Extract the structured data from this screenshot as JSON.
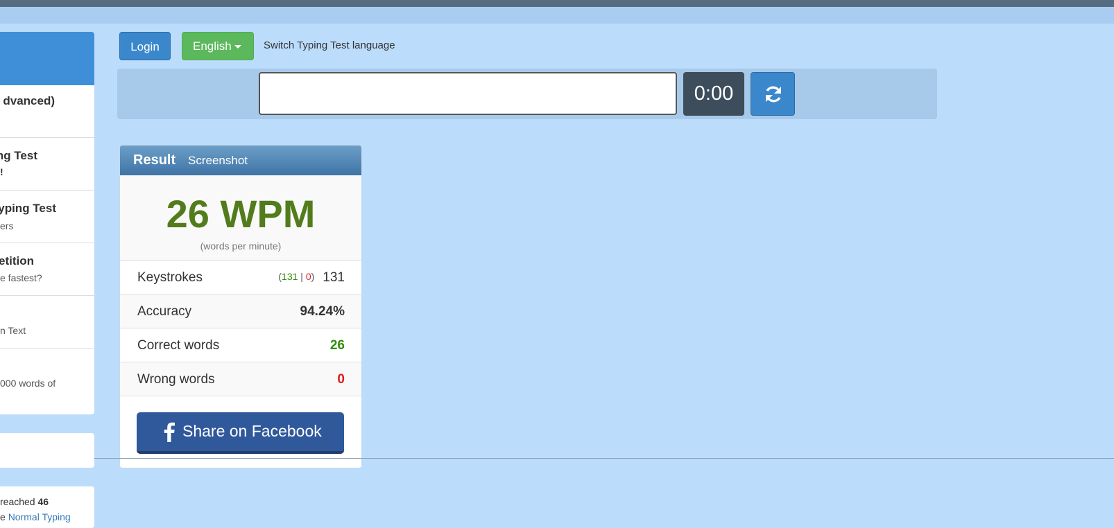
{
  "sidebar": {
    "items": [
      {
        "title": "dvanced)",
        "subtitle": ""
      },
      {
        "title": "ng Test",
        "subtitle": "!"
      },
      {
        "title": "yping Test",
        "subtitle": "ers"
      },
      {
        "title": "etition",
        "subtitle": "e fastest?"
      },
      {
        "title": "",
        "subtitle": "n Text"
      },
      {
        "title": "",
        "subtitle": "000 words of"
      }
    ],
    "bottom": {
      "line1_prefix": "reached ",
      "line1_bold": "46",
      "line2_prefix": "e ",
      "line2_link": "Normal Typing"
    }
  },
  "toolbar": {
    "login_label": "Login",
    "language_label": "English",
    "language_hint": "Switch Typing Test language"
  },
  "typing": {
    "input_value": "",
    "timer": "0:00"
  },
  "result": {
    "title": "Result",
    "screenshot_label": "Screenshot",
    "wpm": "26 WPM",
    "wpm_caption": "(words per minute)",
    "keystrokes_label": "Keystrokes",
    "keystrokes_open": "(",
    "keystrokes_correct": "131",
    "keystrokes_sep": " | ",
    "keystrokes_wrong": "0",
    "keystrokes_close": ")",
    "keystrokes_total": "131",
    "accuracy_label": "Accuracy",
    "accuracy_value": "94.24%",
    "correct_label": "Correct words",
    "correct_value": "26",
    "wrong_label": "Wrong words",
    "wrong_value": "0",
    "share_label": "Share on Facebook"
  },
  "colors": {
    "background": "#bcdcfc",
    "primary": "#3a87cc",
    "success": "#5cb85c",
    "wpm": "#527c1c",
    "correct": "#2f8f0a",
    "wrong": "#e21b1b",
    "facebook": "#30599c"
  },
  "icons": {
    "reload": "refresh-icon",
    "facebook": "facebook-icon",
    "dropdown": "caret-down-icon"
  }
}
